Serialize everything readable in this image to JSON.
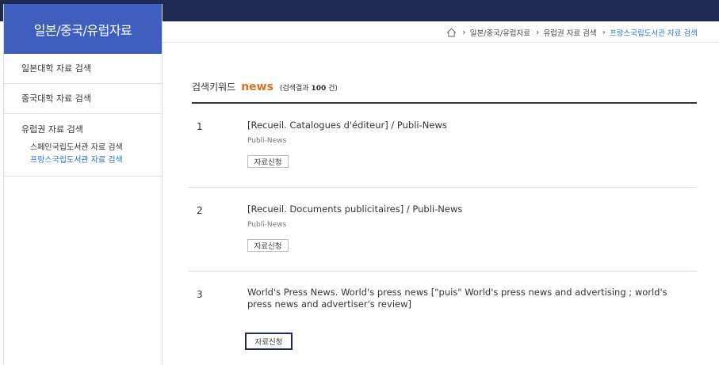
{
  "sidebar": {
    "title": "일본/중국/유럽자료",
    "items": [
      {
        "label": "일본대학 자료 검색"
      },
      {
        "label": "중국대학 자료 검색"
      },
      {
        "label": "유럽권 자료 검색",
        "subitems": [
          {
            "label": "스페인국립도서관 자료 검색"
          },
          {
            "label": "프랑스국립도서관 자료 검색"
          }
        ]
      }
    ]
  },
  "breadcrumb": {
    "items": [
      "일본/중국/유럽자료",
      "유럽권 자료 검색",
      "프랑스국립도서관 자료 검색"
    ]
  },
  "search": {
    "keyword_label": "검색키워드",
    "keyword": "news",
    "count_prefix": "(검색결과",
    "count": "100",
    "count_suffix": "건)"
  },
  "results": [
    {
      "num": "1",
      "title": "[Recueil. Catalogues d'éditeur] / Publi-News",
      "sub": "Publi-News",
      "button": "자료신청"
    },
    {
      "num": "2",
      "title": "[Recueil. Documents publicitaires] / Publi-News",
      "sub": "Publi-News",
      "button": "자료신청"
    },
    {
      "num": "3",
      "title": "World's Press News. World's press news [\"puis\" World's press news and advertising ; world's press news and advertiser's review]",
      "sub": "",
      "button": "자료신청"
    }
  ],
  "colors": {
    "topbar": "#1d2a52",
    "sidebar_header": "#3f5fbe",
    "keyword": "#e07020",
    "active_link": "#2a6fd6"
  }
}
